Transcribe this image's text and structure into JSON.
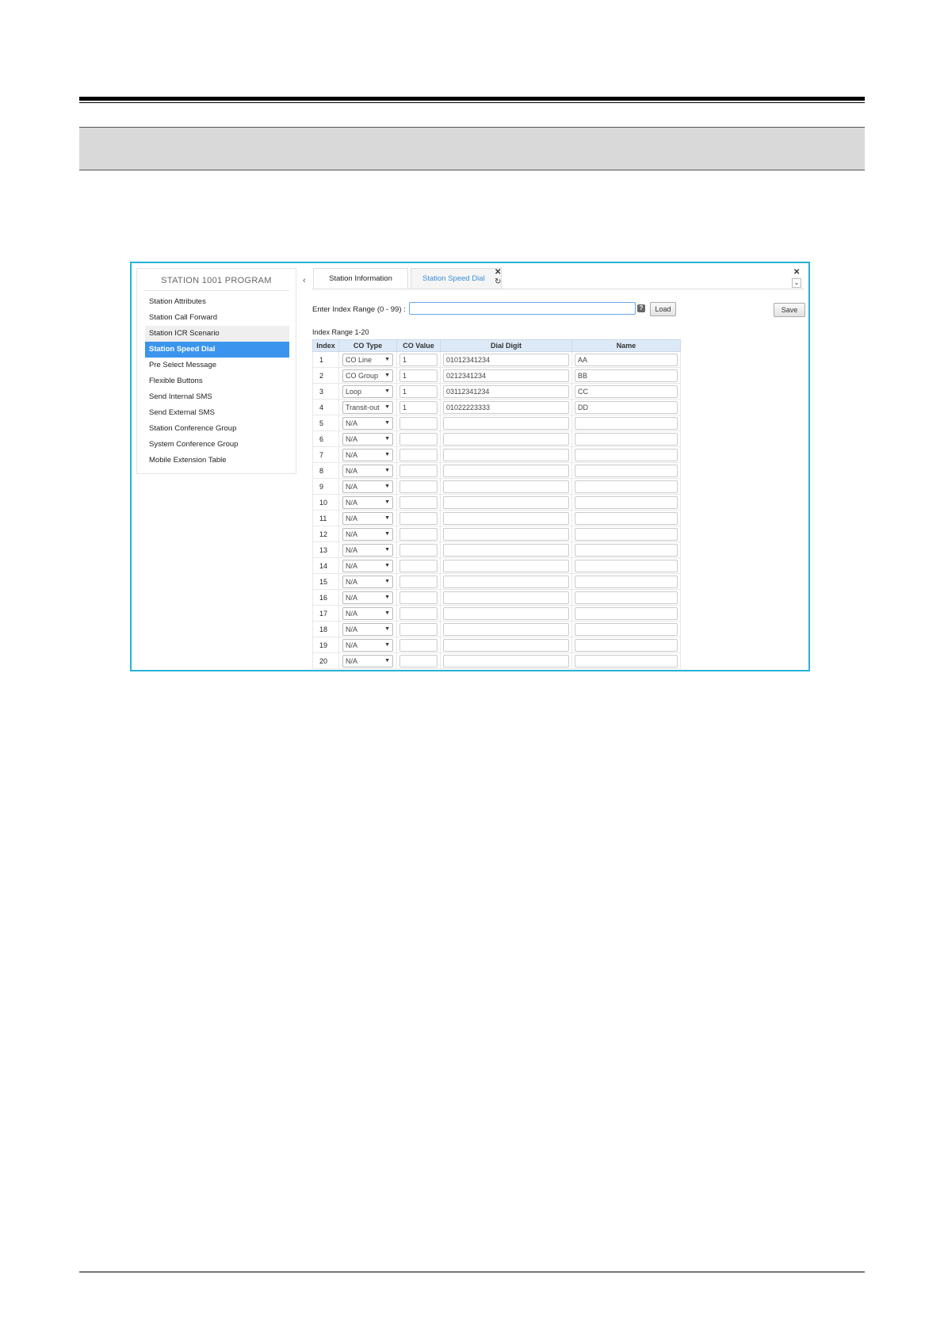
{
  "sidebar": {
    "title": "STATION 1001 PROGRAM",
    "items": [
      {
        "label": "Station Attributes",
        "state": "normal"
      },
      {
        "label": "Station Call Forward",
        "state": "normal"
      },
      {
        "label": "Station ICR Scenario",
        "state": "hover"
      },
      {
        "label": "Station Speed Dial",
        "state": "active"
      },
      {
        "label": "Pre Select Message",
        "state": "normal"
      },
      {
        "label": "Flexible Buttons",
        "state": "normal"
      },
      {
        "label": "Send Internal SMS",
        "state": "normal"
      },
      {
        "label": "Send External SMS",
        "state": "normal"
      },
      {
        "label": "Station Conference Group",
        "state": "normal"
      },
      {
        "label": "System Conference Group",
        "state": "normal"
      },
      {
        "label": "Mobile Extension Table",
        "state": "normal"
      }
    ]
  },
  "tabs": {
    "prev_icon": "chevron-left-icon",
    "items": [
      {
        "label": "Station Information",
        "active": false
      },
      {
        "label": "Station Speed Dial",
        "active": true
      }
    ],
    "close_icon": "close-icon",
    "refresh_icon": "refresh-icon"
  },
  "form": {
    "range_label": "Enter Index Range (0 - 99) :",
    "range_value": "",
    "help_icon": "help-icon",
    "load_label": "Load",
    "save_label": "Save",
    "index_range_text": "Index Range 1-20"
  },
  "table": {
    "headers": [
      "Index",
      "CO Type",
      "CO Value",
      "Dial Digit",
      "Name"
    ],
    "rows": [
      {
        "index": "1",
        "co_type": "CO Line",
        "co_value": "1",
        "dial_digit": "01012341234",
        "name": "AA"
      },
      {
        "index": "2",
        "co_type": "CO Group",
        "co_value": "1",
        "dial_digit": "0212341234",
        "name": "BB"
      },
      {
        "index": "3",
        "co_type": "Loop",
        "co_value": "1",
        "dial_digit": "03112341234",
        "name": "CC"
      },
      {
        "index": "4",
        "co_type": "Transit-out",
        "co_value": "1",
        "dial_digit": "01022223333",
        "name": "DD"
      },
      {
        "index": "5",
        "co_type": "N/A",
        "co_value": "",
        "dial_digit": "",
        "name": ""
      },
      {
        "index": "6",
        "co_type": "N/A",
        "co_value": "",
        "dial_digit": "",
        "name": ""
      },
      {
        "index": "7",
        "co_type": "N/A",
        "co_value": "",
        "dial_digit": "",
        "name": ""
      },
      {
        "index": "8",
        "co_type": "N/A",
        "co_value": "",
        "dial_digit": "",
        "name": ""
      },
      {
        "index": "9",
        "co_type": "N/A",
        "co_value": "",
        "dial_digit": "",
        "name": ""
      },
      {
        "index": "10",
        "co_type": "N/A",
        "co_value": "",
        "dial_digit": "",
        "name": ""
      },
      {
        "index": "11",
        "co_type": "N/A",
        "co_value": "",
        "dial_digit": "",
        "name": ""
      },
      {
        "index": "12",
        "co_type": "N/A",
        "co_value": "",
        "dial_digit": "",
        "name": ""
      },
      {
        "index": "13",
        "co_type": "N/A",
        "co_value": "",
        "dial_digit": "",
        "name": ""
      },
      {
        "index": "14",
        "co_type": "N/A",
        "co_value": "",
        "dial_digit": "",
        "name": ""
      },
      {
        "index": "15",
        "co_type": "N/A",
        "co_value": "",
        "dial_digit": "",
        "name": ""
      },
      {
        "index": "16",
        "co_type": "N/A",
        "co_value": "",
        "dial_digit": "",
        "name": ""
      },
      {
        "index": "17",
        "co_type": "N/A",
        "co_value": "",
        "dial_digit": "",
        "name": ""
      },
      {
        "index": "18",
        "co_type": "N/A",
        "co_value": "",
        "dial_digit": "",
        "name": ""
      },
      {
        "index": "19",
        "co_type": "N/A",
        "co_value": "",
        "dial_digit": "",
        "name": ""
      },
      {
        "index": "20",
        "co_type": "N/A",
        "co_value": "",
        "dial_digit": "",
        "name": ""
      }
    ]
  },
  "colors": {
    "frame_border": "#28b2d6",
    "active_item_bg": "#3b95ee",
    "header_bg": "#dde9f7"
  }
}
